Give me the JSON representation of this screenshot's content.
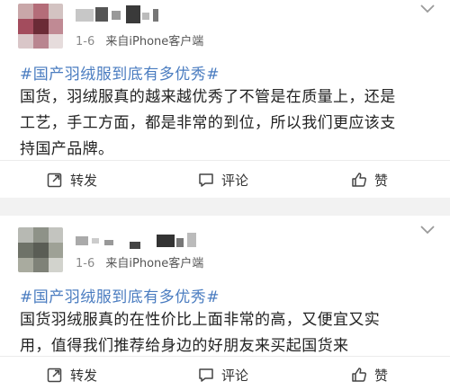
{
  "posts": [
    {
      "meta": {
        "date": "1-6",
        "source_prefix": "来自",
        "client": "iPhone客户端"
      },
      "topic": "#国产羽绒服到底有多优秀#",
      "body_lines": [
        "国货，羽绒服真的越来越优秀了不管是在质量上，还是",
        "工艺，手工方面，都是非常的到位，所以我们更应该支",
        "持国产品牌。"
      ],
      "actions": {
        "repost": "转发",
        "comment": "评论",
        "like": "赞"
      }
    },
    {
      "meta": {
        "date": "1-6",
        "source_prefix": "来自",
        "client": "iPhone客户端"
      },
      "topic": "#国产羽绒服到底有多优秀#",
      "body_lines": [
        "国货羽绒服真的在性价比上面非常的高，又便宜又实",
        "用，值得我们推荐给身边的好朋友来买起国货来"
      ],
      "actions": {
        "repost": "转发",
        "comment": "评论",
        "like": "赞"
      }
    }
  ],
  "icons": {
    "repost": "repost-icon",
    "comment": "comment-icon",
    "like": "thumbs-up-icon",
    "menu": "chevron-down-icon"
  },
  "colors": {
    "topic": "#4a7cc0",
    "meta": "#8a8a8a",
    "background": "#f2f2f2"
  }
}
